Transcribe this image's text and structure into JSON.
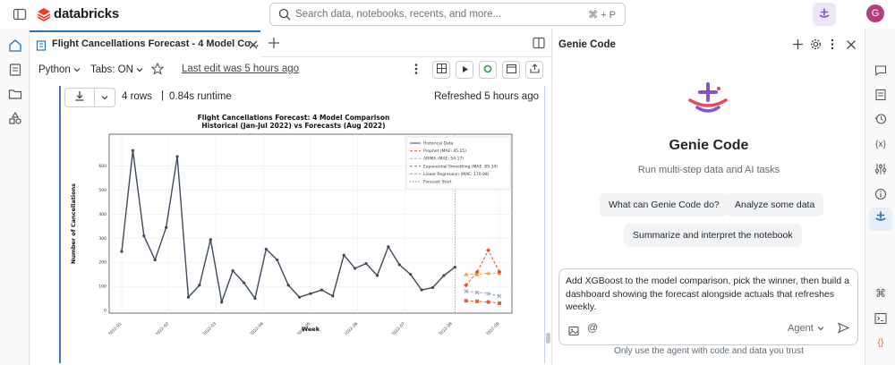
{
  "brand": {
    "name": "databricks"
  },
  "search": {
    "placeholder": "Search data, notebooks, recents, and more...",
    "shortcut": "⌘ + P"
  },
  "user": {
    "initial": "G"
  },
  "tab": {
    "title": "Flight Cancellations Forecast - 4 Model Co..."
  },
  "toolbar": {
    "language": "Python",
    "tabs": "Tabs: ON",
    "last_edit": "Last edit was 5 hours ago"
  },
  "cell": {
    "rows": "4 rows",
    "runtime": "0.84s runtime",
    "refreshed": "Refreshed 5 hours ago"
  },
  "chart_data": {
    "type": "line",
    "title": "Flight Cancellations Forecast: 4 Model Comparison",
    "subtitle": "Historical (Jan-Jul 2022) vs Forecasts (Aug 2022)",
    "xlabel": "Week",
    "ylabel": "Number of Cancellations",
    "ylim": [
      0,
      700
    ],
    "yticks": [
      0,
      100,
      200,
      300,
      400,
      500,
      600
    ],
    "xticks": [
      "2022-01",
      "2022-02",
      "2022-03",
      "2022-04",
      "2022-05",
      "2022-06",
      "2022-07",
      "2022-08",
      "2022-09"
    ],
    "grid": true,
    "legend_position": "top-right",
    "legend": [
      "Historical Data",
      "Prophet (MAE: 45.15)",
      "ARIMA (MAE: 54.17)",
      "Exponential Smoothing (MAE: 89.34)",
      "Linear Regression (MAE: 170.98)",
      "Forecast Start"
    ],
    "historical": [
      245,
      665,
      310,
      210,
      345,
      640,
      55,
      105,
      295,
      35,
      165,
      115,
      50,
      255,
      210,
      105,
      55,
      70,
      85,
      60,
      230,
      175,
      195,
      145,
      265,
      190,
      150,
      85,
      95,
      145,
      180
    ],
    "forecast_start_index": 30,
    "series": [
      {
        "name": "Prophet (MAE: 45.15)",
        "color": "#e8613c",
        "values": [
          40,
          38,
          35,
          30
        ]
      },
      {
        "name": "ARIMA (MAE: 54.17)",
        "color": "#f0a050",
        "values": [
          150,
          150,
          155,
          155
        ]
      },
      {
        "name": "Exponential Smoothing (MAE: 89.34)",
        "color": "#d8552a",
        "values": [
          105,
          160,
          250,
          160
        ]
      },
      {
        "name": "Linear Regression (MAE: 170.98)",
        "color": "#8fa4c4",
        "values": [
          80,
          75,
          70,
          60
        ]
      }
    ]
  },
  "genie": {
    "title": "Genie Code",
    "heading": "Genie Code",
    "subtitle": "Run multi-step data and AI tasks",
    "chips": [
      "What can Genie Code do?",
      "Analyze some data",
      "Summarize and interpret the notebook"
    ],
    "prompt": "Add XGBoost to the model comparison, pick the winner, then build a dashboard showing the forecast alongside actuals that refreshes weekly.",
    "agent_label": "Agent",
    "footer": "Only use the agent with code and data you trust"
  },
  "colors": {
    "accent": "#ff3621",
    "genie_purple": "#7e57c2",
    "history_line": "#3d4a5c"
  }
}
